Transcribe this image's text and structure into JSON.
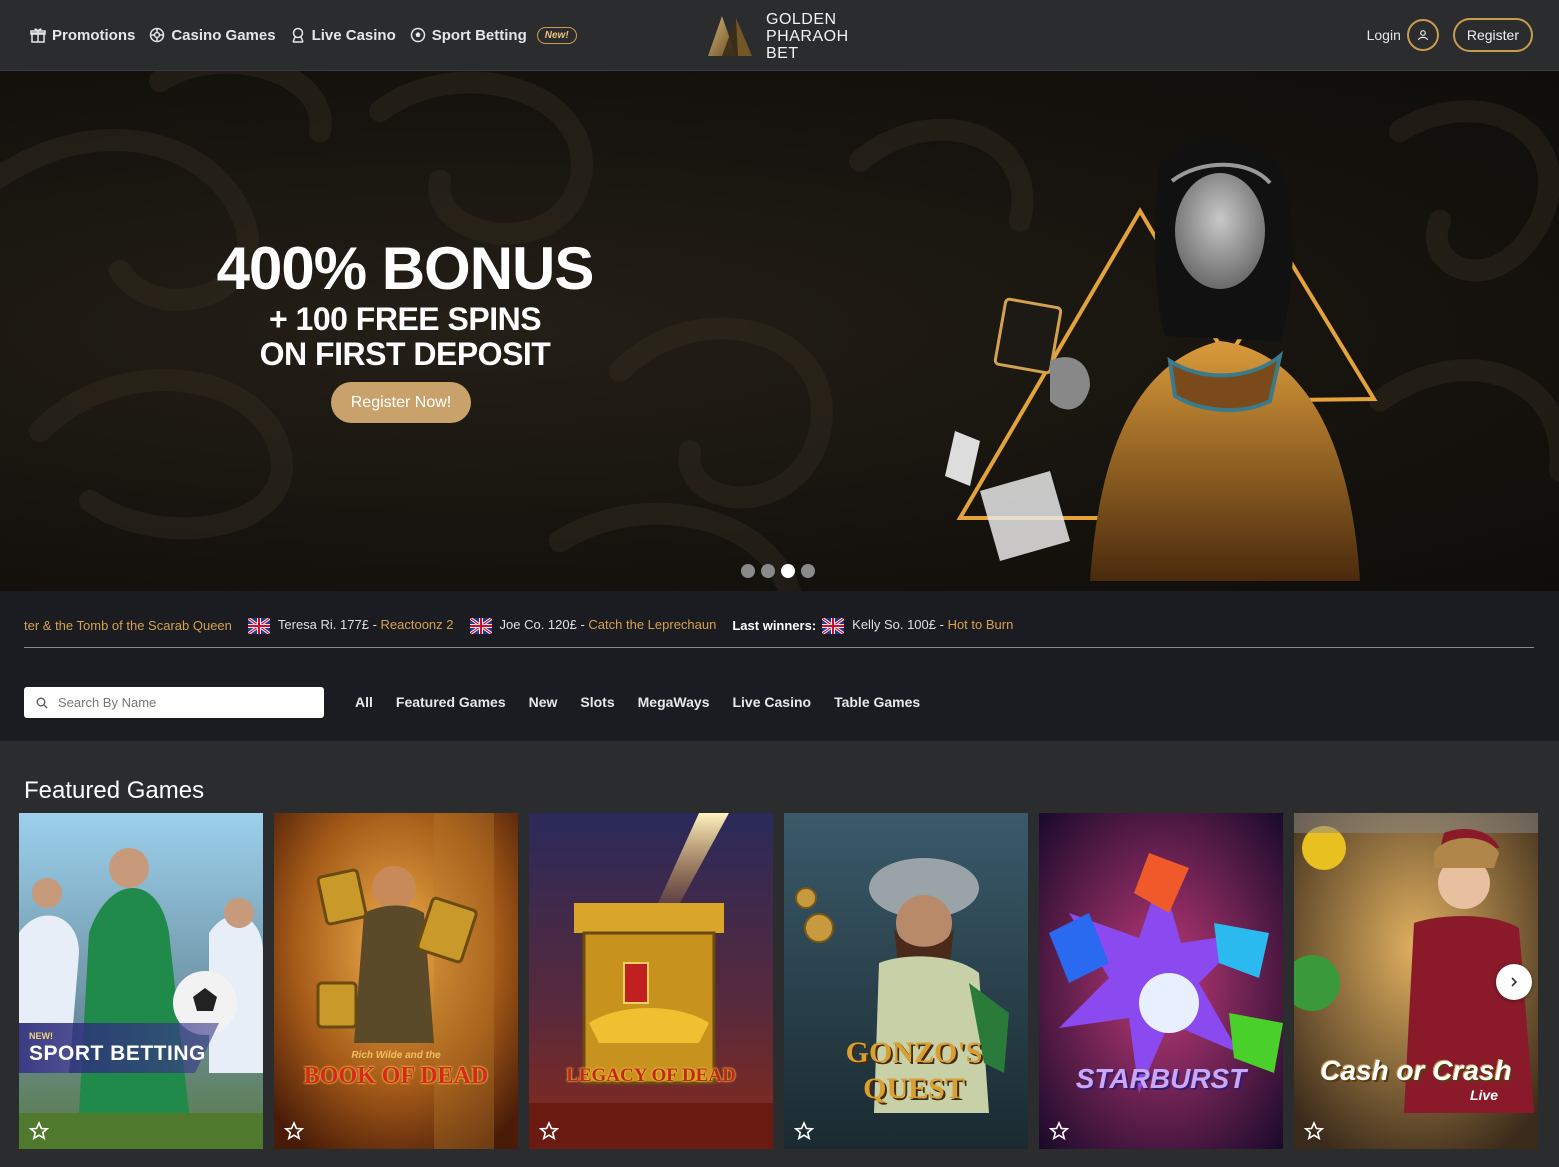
{
  "header": {
    "nav": [
      {
        "label": "Promotions",
        "icon": "gift-icon"
      },
      {
        "label": "Casino Games",
        "icon": "chip-icon"
      },
      {
        "label": "Live Casino",
        "icon": "dealer-icon"
      },
      {
        "label": "Sport Betting",
        "icon": "soccer-ball-icon"
      }
    ],
    "new_badge": "New!",
    "logo_line1": "GOLDEN",
    "logo_line2": "PHARAOH",
    "logo_line3": "BET",
    "login_label": "Login",
    "register_label": "Register"
  },
  "hero": {
    "headline": "400% BONUS",
    "subline1": "+ 100 FREE SPINS",
    "subline2": "ON FIRST DEPOSIT",
    "cta": "Register Now!",
    "slides_total": 4,
    "active_slide": 3
  },
  "winners": {
    "truncated_game": "ter & the Tomb of the Scarab Queen",
    "items": [
      {
        "name": "Teresa Ri. 177£",
        "game": "Reactoonz 2"
      },
      {
        "name": "Joe Co. 120£",
        "game": "Catch the Leprechaun"
      }
    ],
    "last_label": "Last winners:",
    "last_item": {
      "name": "Kelly So. 100£",
      "game": "Hot to Burn"
    },
    "separator": " - "
  },
  "search": {
    "placeholder": "Search By Name"
  },
  "filters": [
    "All",
    "Featured Games",
    "New",
    "Slots",
    "MegaWays",
    "Live Casino",
    "Table Games"
  ],
  "featured": {
    "title": "Featured Games",
    "games": [
      {
        "title": "SPORT BETTING",
        "badge": "NEW!"
      },
      {
        "title": "BOOK OF DEAD",
        "subtitle": "Rich Wilde and the"
      },
      {
        "title": "LEGACY OF DEAD"
      },
      {
        "title": "GONZO'S QUEST"
      },
      {
        "title": "STARBURST"
      },
      {
        "title": "Cash or Crash",
        "subtitle": "Live"
      }
    ]
  },
  "colors": {
    "gold": "#c89b4e",
    "cta": "#c9a16a",
    "header_bg": "#2b2c2e",
    "section_bg": "#1b1c21"
  }
}
